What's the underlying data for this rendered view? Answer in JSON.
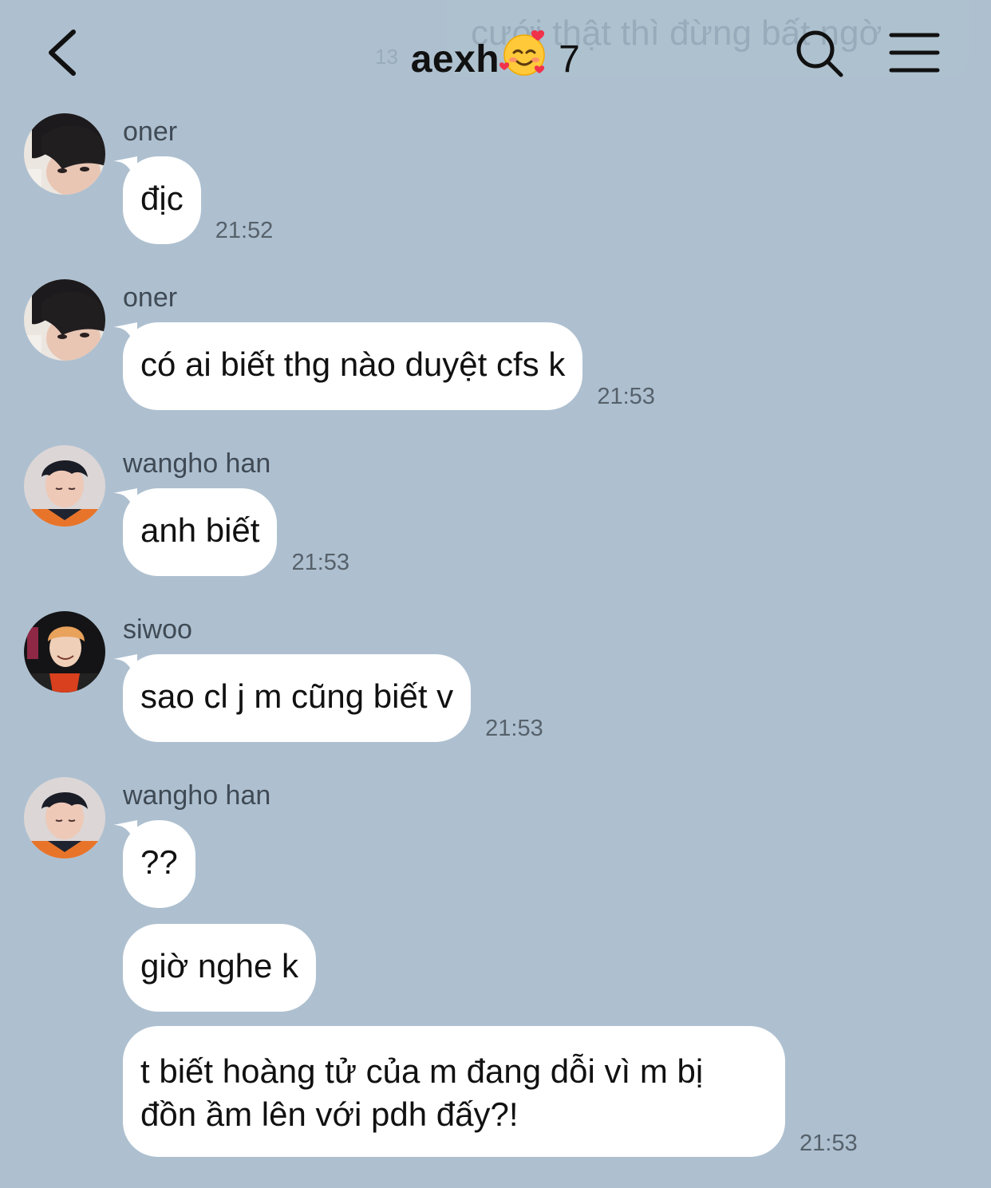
{
  "header": {
    "title": "aexh",
    "member_count": "7",
    "ghost_preview_text": "cưới thật thì đừng bất ngờ",
    "ghost_preview_time": "13"
  },
  "messages": [
    {
      "sender": "oner",
      "avatar": "avatar-oner",
      "bubbles": [
        "địc"
      ],
      "time": "21:52"
    },
    {
      "sender": "oner",
      "avatar": "avatar-oner",
      "bubbles": [
        "có ai biết thg nào duyệt cfs k"
      ],
      "time": "21:53"
    },
    {
      "sender": "wangho han",
      "avatar": "avatar-wangho",
      "bubbles": [
        "anh biết"
      ],
      "time": "21:53"
    },
    {
      "sender": "siwoo",
      "avatar": "avatar-siwoo",
      "bubbles": [
        "sao cl j m cũng biết v"
      ],
      "time": "21:53"
    },
    {
      "sender": "wangho han",
      "avatar": "avatar-wangho",
      "bubbles": [
        "??",
        "giờ nghe k",
        "t biết hoàng tử của m đang dỗi vì m bị đồn ầm lên với pdh đấy?!"
      ],
      "time": "21:53"
    }
  ]
}
